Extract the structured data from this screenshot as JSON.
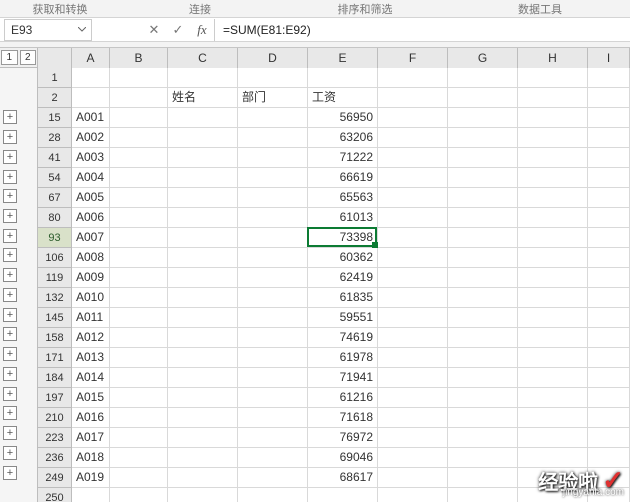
{
  "ribbon": {
    "group1": "获取和转换",
    "group2": "连接",
    "group3": "排序和筛选",
    "group4": "数据工具"
  },
  "formula_bar": {
    "name_box": "E93",
    "cancel": "✕",
    "confirm": "✓",
    "fx": "fx",
    "formula": "=SUM(E81:E92)"
  },
  "outline": {
    "level1": "1",
    "level2": "2"
  },
  "columns": [
    "A",
    "B",
    "C",
    "D",
    "E",
    "F",
    "G",
    "H",
    "I"
  ],
  "header_row": {
    "row_num": 2,
    "B": "",
    "C": "姓名",
    "D": "部门",
    "E": "工资"
  },
  "top_blank_row": 1,
  "data_rows": [
    {
      "row": 15,
      "A": "A001",
      "E": 56950
    },
    {
      "row": 28,
      "A": "A002",
      "E": 63206
    },
    {
      "row": 41,
      "A": "A003",
      "E": 71222
    },
    {
      "row": 54,
      "A": "A004",
      "E": 66619
    },
    {
      "row": 67,
      "A": "A005",
      "E": 65563
    },
    {
      "row": 80,
      "A": "A006",
      "E": 61013
    },
    {
      "row": 93,
      "A": "A007",
      "E": 73398
    },
    {
      "row": 106,
      "A": "A008",
      "E": 60362
    },
    {
      "row": 119,
      "A": "A009",
      "E": 62419
    },
    {
      "row": 132,
      "A": "A010",
      "E": 61835
    },
    {
      "row": 145,
      "A": "A011",
      "E": 59551
    },
    {
      "row": 158,
      "A": "A012",
      "E": 74619
    },
    {
      "row": 171,
      "A": "A013",
      "E": 61978
    },
    {
      "row": 184,
      "A": "A014",
      "E": 71941
    },
    {
      "row": 197,
      "A": "A015",
      "E": 61216
    },
    {
      "row": 210,
      "A": "A016",
      "E": 71618
    },
    {
      "row": 223,
      "A": "A017",
      "E": 76972
    },
    {
      "row": 236,
      "A": "A018",
      "E": 69046
    },
    {
      "row": 249,
      "A": "A019",
      "E": 68617
    }
  ],
  "trailing_rows": [
    250
  ],
  "active_cell": {
    "col": "E",
    "row_index": 8
  },
  "watermark": {
    "text": "经验啦",
    "check": "✓",
    "url": "jingyanla.com"
  },
  "chart_data": {
    "type": "table",
    "title": "工资",
    "columns": [
      "A",
      "工资"
    ],
    "rows": [
      [
        "A001",
        56950
      ],
      [
        "A002",
        63206
      ],
      [
        "A003",
        71222
      ],
      [
        "A004",
        66619
      ],
      [
        "A005",
        65563
      ],
      [
        "A006",
        61013
      ],
      [
        "A007",
        73398
      ],
      [
        "A008",
        60362
      ],
      [
        "A009",
        62419
      ],
      [
        "A010",
        61835
      ],
      [
        "A011",
        59551
      ],
      [
        "A012",
        74619
      ],
      [
        "A013",
        61978
      ],
      [
        "A014",
        71941
      ],
      [
        "A015",
        61216
      ],
      [
        "A016",
        71618
      ],
      [
        "A017",
        76972
      ],
      [
        "A018",
        69046
      ],
      [
        "A019",
        68617
      ]
    ]
  }
}
